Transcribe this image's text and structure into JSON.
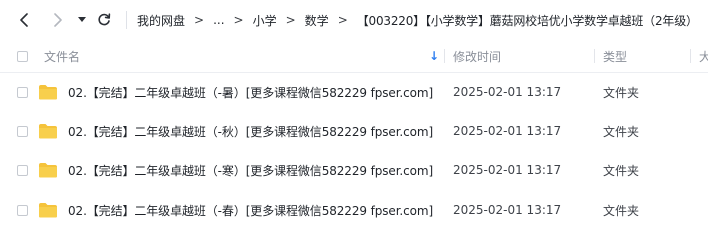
{
  "nav": {
    "back_icon": "chevron-left-icon",
    "forward_icon": "chevron-right-icon",
    "menu_icon": "caret-down-icon",
    "refresh_icon": "refresh-icon"
  },
  "breadcrumb": {
    "items": [
      "我的网盘",
      "...",
      "小学",
      "数学",
      "【003220】【小学数学】蘑菇网校培优小学数学卓越班（2年级）"
    ],
    "separator": ">"
  },
  "table": {
    "columns": {
      "name": "文件名",
      "modified": "修改时间",
      "type": "类型",
      "extra": "大"
    },
    "sort_indicator": "↓",
    "rows": [
      {
        "name": "02.【完结】二年级卓越班（-暑）[更多课程微信582229 fpser.com]",
        "modified": "2025-02-01 13:17",
        "type": "文件夹",
        "icon": "folder-icon"
      },
      {
        "name": "02.【完结】二年级卓越班（-秋）[更多课程微信582229 fpser.com]",
        "modified": "2025-02-01 13:17",
        "type": "文件夹",
        "icon": "folder-icon"
      },
      {
        "name": "02.【完结】二年级卓越班（-寒）[更多课程微信582229 fpser.com]",
        "modified": "2025-02-01 13:17",
        "type": "文件夹",
        "icon": "folder-icon"
      },
      {
        "name": "02.【完结】二年级卓越班（-春）[更多课程微信582229 fpser.com]",
        "modified": "2025-02-01 13:17",
        "type": "文件夹",
        "icon": "folder-icon"
      }
    ]
  },
  "colors": {
    "folder": "#f5c33b",
    "sort_arrow": "#2f7ff0",
    "header_text": "#8a8f99"
  }
}
